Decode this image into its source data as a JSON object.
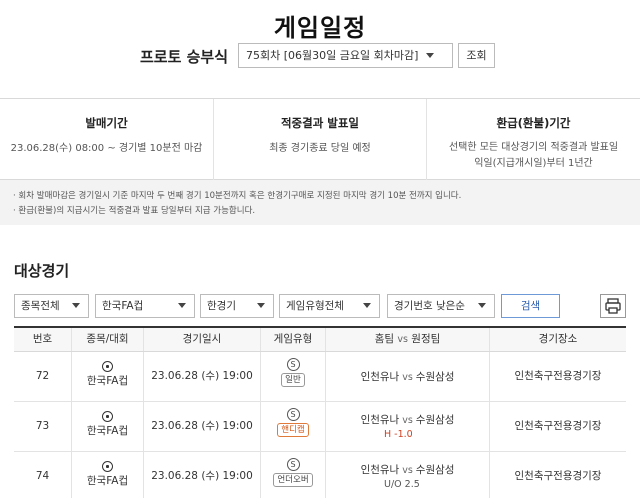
{
  "page": {
    "title": "게임일정"
  },
  "round": {
    "label": "프로토 승부식",
    "selected": "75회차 [06월30일 금요일 회차마감]",
    "lookup_button": "조회"
  },
  "info": [
    {
      "heading": "발매기간",
      "lines": [
        "23.06.28(수) 08:00 ~ 경기별 10분전 마감"
      ]
    },
    {
      "heading": "적중결과 발표일",
      "lines": [
        "최종 경기종료 당일 예정"
      ]
    },
    {
      "heading": "환급(환불)기간",
      "lines": [
        "선택한 모든 대상경기의 적중결과 발표일",
        "익일(지급개시일)부터 1년간"
      ]
    }
  ],
  "notices": [
    "· 회차 발매마감은 경기일시 기준 마지막 두 번째 경기 10분전까지 혹은 한경기구매로 지정된 마지막 경기 10분 전까지 입니다.",
    "· 환급(환불)의 지급시기는 적중결과 발표 당일부터 지급 가능합니다."
  ],
  "section": {
    "title": "대상경기"
  },
  "filters": {
    "sport": "종목전체",
    "league": "한국FA컵",
    "single": "한경기",
    "game_type": "게임유형전체",
    "sort": "경기번호 낮은순",
    "search_button": "검색",
    "print_icon": "printer-icon"
  },
  "table": {
    "headers": [
      "번호",
      "종목/대회",
      "경기일시",
      "게임유형",
      "홈팀",
      "vs",
      "원정팀",
      "경기장소"
    ],
    "rows": [
      {
        "no": "72",
        "league": "한국FA컵",
        "datetime": "23.06.28 (수) 19:00",
        "s": "S",
        "type": "일반",
        "home": "인천유나",
        "vs": "vs",
        "away": "수원삼성",
        "sub": "",
        "venue": "인천축구전용경기장"
      },
      {
        "no": "73",
        "league": "한국FA컵",
        "datetime": "23.06.28 (수) 19:00",
        "s": "S",
        "type": "핸디캡",
        "home": "인천유나",
        "vs": "vs",
        "away": "수원삼성",
        "sub": "H -1.0",
        "venue": "인천축구전용경기장"
      },
      {
        "no": "74",
        "league": "한국FA컵",
        "datetime": "23.06.28 (수) 19:00",
        "s": "S",
        "type": "언더오버",
        "home": "인천유나",
        "vs": "vs",
        "away": "수원삼성",
        "sub": "U/O 2.5",
        "venue": "인천축구전용경기장"
      }
    ]
  },
  "colors": {
    "search_border": "#6e9ad8",
    "handicap_orange": "#e07a3a",
    "handicap_text": "#d04020"
  }
}
